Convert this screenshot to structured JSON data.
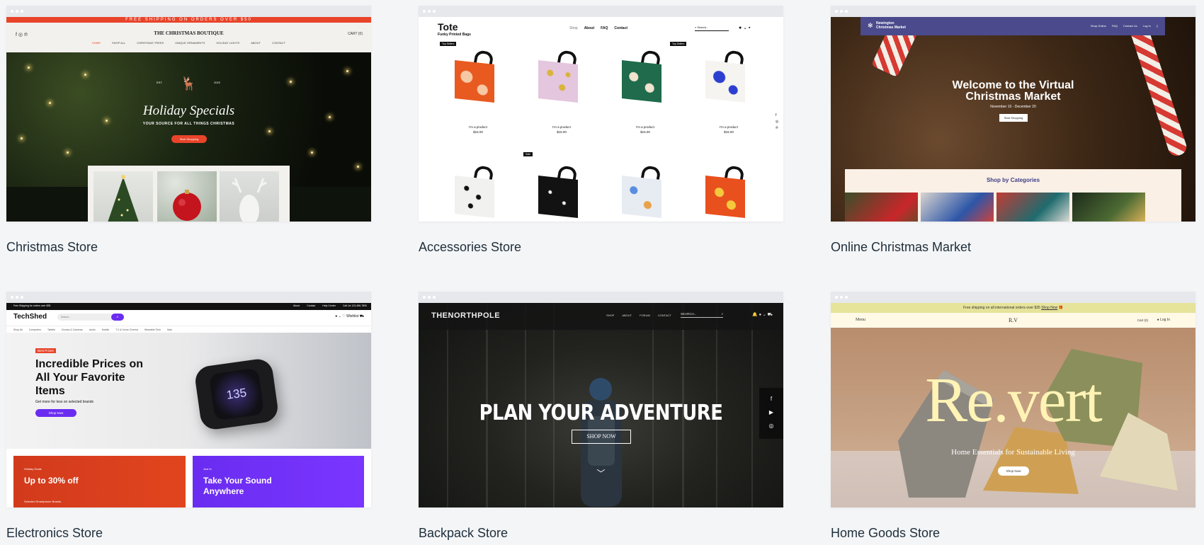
{
  "templates": [
    {
      "title": "Christmas Store",
      "promo": "FREE SHIPPING ON ORDERS OVER $50",
      "brand": "THE CHRISTMAS BOUTIQUE",
      "cart": "CART (0)",
      "nav": [
        "HOME",
        "SHOP ALL",
        "CHRISTMAS TREES",
        "UNIQUE ORNAMENTS",
        "HOLIDAY LIGHTS",
        "ABOUT",
        "CONTACT"
      ],
      "est": "EST.",
      "year": "2022",
      "headline": "Holiday Specials",
      "subhead": "YOUR SOURCE FOR ALL THINGS CHRISTMAS",
      "cta": "Start Shopping"
    },
    {
      "title": "Accessories Store",
      "logo": "Tote",
      "tagline": "Funky Printed Bags",
      "nav": [
        "Shop",
        "About",
        "FAQ",
        "Contact"
      ],
      "search_placeholder": "Search...",
      "badge_top": "Top Sellers",
      "badge_sale": "Sale",
      "product_name": "I'm a product",
      "product_price": "$15.00"
    },
    {
      "title": "Online Christmas Market",
      "brand_line1": "Newington",
      "brand_line2": "Christmas Market",
      "nav": [
        "Shop Online",
        "FAQ",
        "Contact Us",
        "Log In"
      ],
      "headline": "Welcome to the Virtual Christmas Market",
      "dates": "November 10 - December 20",
      "cta": "Start Shopping",
      "categories_title": "Shop by Categories"
    },
    {
      "title": "Electronics Store",
      "topbar": "Free Shipping for orders over $35",
      "topbar_links": [
        "About",
        "Contact",
        "Help Center",
        "Call Us 123-456-7890"
      ],
      "logo": "TechShed",
      "search_placeholder": "Search...",
      "wishlist": "Wishlist",
      "categories": [
        "Shop All",
        "Computers",
        "Tablets",
        "Drones & Cameras",
        "Audio",
        "Mobile",
        "T.V & Home Cinema",
        "Wearable Tech",
        "Sale"
      ],
      "badge": "Best Prices",
      "headline": "Incredible Prices on All Your Favorite Items",
      "subhead": "Get more for less on selected brands",
      "cta": "Shop Now",
      "watch_readout": "135",
      "deal1_kicker": "Holiday Deals",
      "deal1_title": "Up to 30% off",
      "deal1_sub": "Selected Smartphone Brands",
      "deal2_kicker": "Just In",
      "deal2_title": "Take Your Sound Anywhere"
    },
    {
      "title": "Backpack Store",
      "logo": "THENORTHPOLE",
      "nav": [
        "SHOP",
        "ABOUT",
        "FORUM",
        "CONTACT"
      ],
      "search_placeholder": "SEARCH...",
      "headline": "PLAN YOUR ADVENTURE",
      "cta": "SHOP NOW"
    },
    {
      "title": "Home Goods Store",
      "promo": "Free shipping on all international orders over $35",
      "promo_link": "Shop Now",
      "menu": "Menu",
      "logo": "R.V",
      "cart": "Cart (0)",
      "login": "Log In",
      "headline": "Re.vert",
      "subhead": "Home Essentials for Sustainable Living",
      "cta": "Shop Now"
    }
  ]
}
